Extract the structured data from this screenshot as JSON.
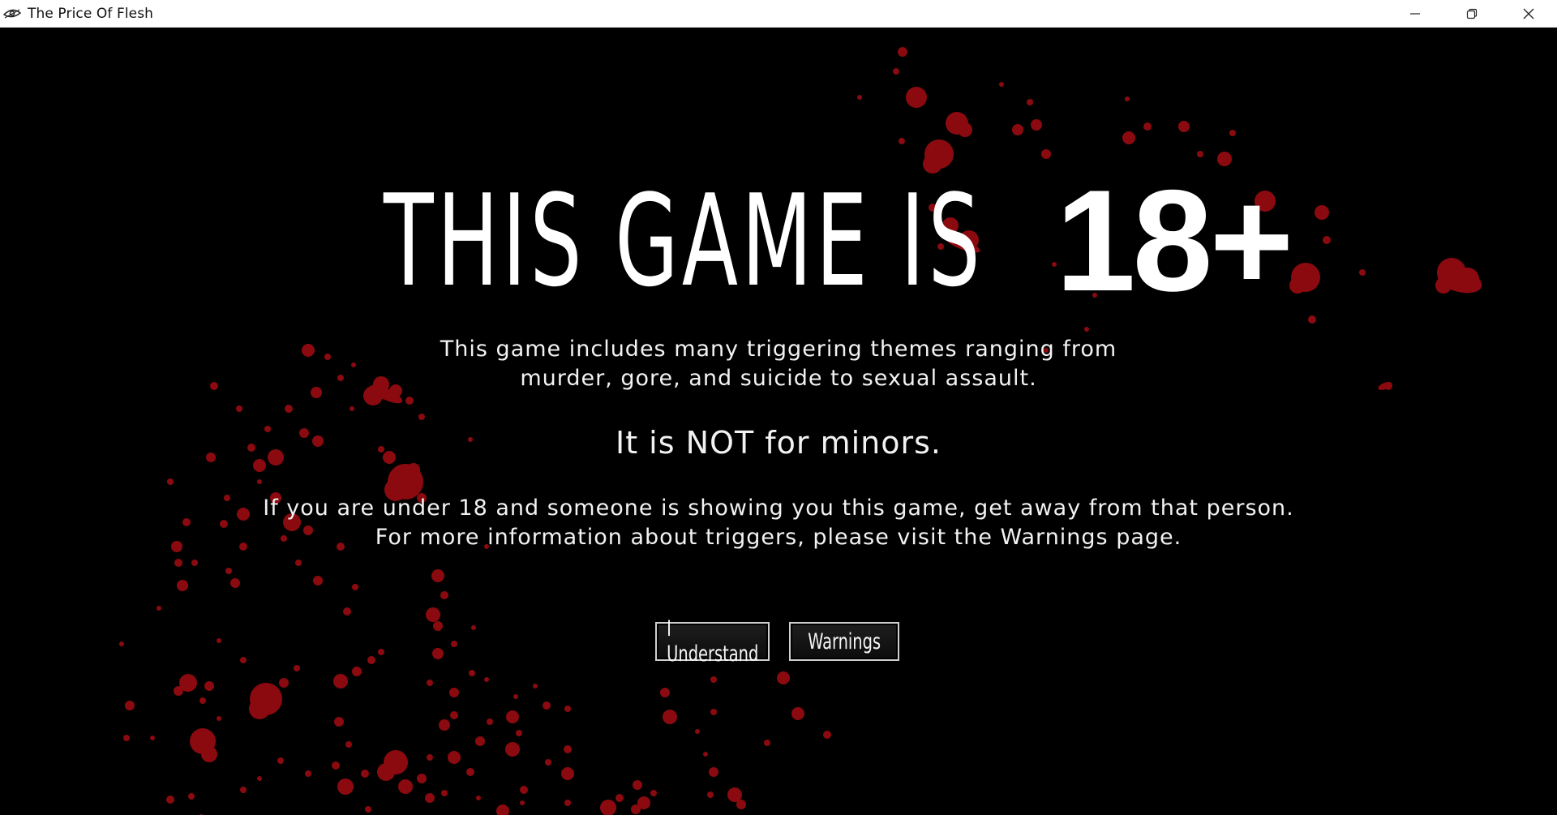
{
  "window": {
    "title": "The Price Of Flesh",
    "app_icon": "eye-icon",
    "controls": [
      "minimize-icon",
      "restore-icon",
      "close-icon"
    ]
  },
  "headline": {
    "part1": "THIS GAME IS",
    "part2": "18+"
  },
  "body": {
    "line1": "This game includes many triggering themes ranging from",
    "line2": "murder, gore, and suicide to sexual assault.",
    "warning": "It is NOT for minors.",
    "line3": "If you are under 18 and someone is showing you this game, get away from that person.",
    "line4": "For more information about triggers, please visit the Warnings page."
  },
  "buttons": {
    "understand": "I Understand",
    "warnings": "Warnings"
  },
  "colors": {
    "background": "#000000",
    "text": "#ffffff",
    "blood": "#8b0a0f",
    "titlebar": "#ffffff"
  }
}
